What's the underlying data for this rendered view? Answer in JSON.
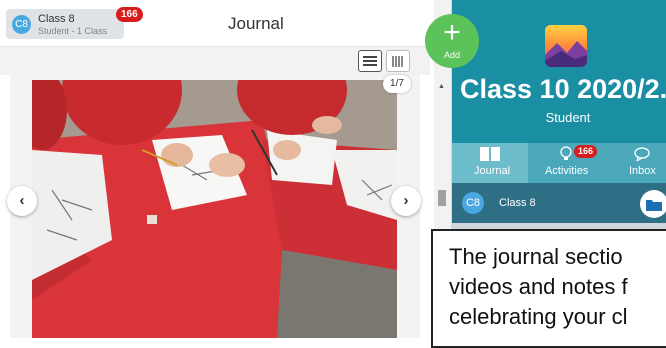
{
  "header": {
    "class_avatar": "C8",
    "class_name": "Class 8",
    "class_subtitle": "Student - 1 Class",
    "notification_count": "166",
    "page_title": "Journal"
  },
  "gallery": {
    "counter": "1/7",
    "prev_icon": "chevron-left-icon",
    "next_icon": "chevron-right-icon"
  },
  "add_button": {
    "label": "Add"
  },
  "class_panel": {
    "name": "Class 10 2020/2...",
    "role": "Student",
    "tabs": [
      {
        "label": "Journal",
        "icon": "book-icon"
      },
      {
        "label": "Activities",
        "icon": "lightbulb-icon",
        "badge": "166"
      },
      {
        "label": "Inbox",
        "icon": "chat-icon"
      }
    ],
    "current_class": {
      "avatar": "C8",
      "name": "Class 8"
    }
  },
  "callout": {
    "lines": [
      "The journal sectio",
      "videos and notes f",
      "celebrating your cl"
    ]
  },
  "colors": {
    "teal": "#1a8fa3",
    "add_green": "#5cc25a",
    "badge_red": "#d81b1b"
  }
}
